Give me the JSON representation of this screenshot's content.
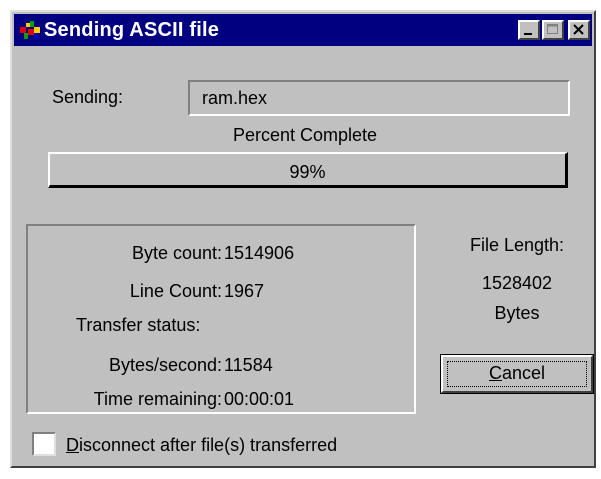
{
  "window": {
    "title": "Sending ASCII file",
    "icons": {
      "app": "terminal-app-icon",
      "minimize": "minimize-icon",
      "maximize": "maximize-icon",
      "close": "close-icon"
    }
  },
  "sending": {
    "label": "Sending:",
    "file_name": "ram.hex"
  },
  "progress": {
    "label": "Percent Complete",
    "percent_text": "99%",
    "value": 0.99
  },
  "stats": {
    "byte_count_label": "Byte count:",
    "byte_count": "1514906",
    "line_count_label": "Line Count:",
    "line_count": "1967",
    "transfer_status_label": "Transfer status:",
    "bytes_per_second_label": "Bytes/second:",
    "bytes_per_second": "11584",
    "time_remaining_label": "Time remaining:",
    "time_remaining": "00:00:01"
  },
  "file_length": {
    "label": "File Length:",
    "value": "1528402",
    "unit": "Bytes"
  },
  "cancel_button": {
    "mnemonic": "C",
    "rest": "ancel"
  },
  "disconnect": {
    "mnemonic": "D",
    "rest": "isconnect after file(s) transferred",
    "checked": false
  },
  "colors": {
    "title_bar": "#000080",
    "face": "#c0c0c0"
  }
}
